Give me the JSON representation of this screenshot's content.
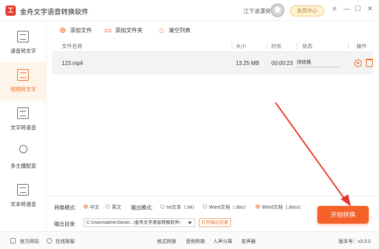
{
  "app": {
    "title": "金舟文字语音转换软件",
    "logo_glyph": "工",
    "user_name": "江下凌漂突",
    "vip_label": "会员中心",
    "window_controls": [
      "≡",
      "—",
      "☐",
      "✕"
    ]
  },
  "sidebar": {
    "items": [
      {
        "label": "语音转文字",
        "icon": "speech-to-text-icon",
        "active": false
      },
      {
        "label": "视频转文字",
        "icon": "video-to-text-icon",
        "active": true
      },
      {
        "label": "文字转语音",
        "icon": "text-to-speech-icon",
        "active": false
      },
      {
        "label": "多主播配音",
        "icon": "multi-voice-icon",
        "active": false
      },
      {
        "label": "文本转语音",
        "icon": "document-to-speech-icon",
        "active": false
      }
    ]
  },
  "toolbar": {
    "add_file": "添加文件",
    "add_folder": "添加文件夹",
    "clear_list": "清空列表"
  },
  "table": {
    "headers": [
      "文件名称",
      "大小",
      "时长",
      "状态",
      "操作"
    ],
    "rows": [
      {
        "name": "123.mp4",
        "size": "13.25 MB",
        "duration": "00:00:23",
        "status": "待转换"
      }
    ]
  },
  "settings": {
    "convert_mode_label": "转换模式:",
    "convert_modes": [
      {
        "label": "中文",
        "checked": true
      },
      {
        "label": "英文",
        "checked": false
      }
    ],
    "output_format_label": "输出模式:",
    "output_formats": [
      {
        "label": "txt文本（.txt）",
        "checked": false
      },
      {
        "label": "Word文档（.doc）",
        "checked": false
      },
      {
        "label": "Word文档（.docx）",
        "checked": true
      }
    ],
    "output_dir_label": "输出目录:",
    "output_dir_value": "C:\\Users\\admin\\Deskt...\\金舟文字语音转换软件\\",
    "open_dir_label": "打开输出目录",
    "start_label": "开始转换"
  },
  "footer": {
    "website": "官方网站",
    "support": "在线客服",
    "tools": [
      "格式转换",
      "音频剪辑",
      "人声分离",
      "变声器"
    ],
    "version": "版本号：v3.0.0"
  },
  "colors": {
    "accent": "#f06a1f",
    "start_button": "#f4622a",
    "annotation_arrow": "#e8382c"
  }
}
